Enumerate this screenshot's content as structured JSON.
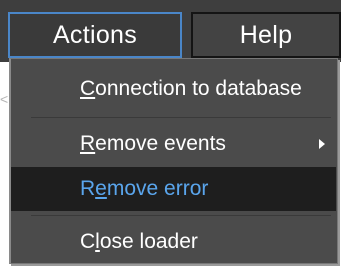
{
  "menubar": {
    "items": [
      {
        "label": "Actions",
        "state": "open"
      },
      {
        "label": "Help"
      }
    ]
  },
  "side_mark": "<",
  "dropdown": {
    "items": [
      {
        "label": "Connection to database",
        "mnemonic": "C",
        "has_submenu": false
      },
      {
        "label": "Remove events",
        "mnemonic": "R",
        "has_submenu": true,
        "submenu_icon": "chevron-right-icon"
      },
      {
        "label": "Remove error",
        "mnemonic": "e",
        "has_submenu": false,
        "selected": true
      },
      {
        "label": "Close loader",
        "mnemonic": "l",
        "has_submenu": false
      }
    ]
  },
  "colors": {
    "menubar_bg": "#3e3e3e",
    "menu_bg": "#4b4b4b",
    "highlight_bg": "#1e1e1e",
    "highlight_text": "#5aa5ec",
    "focus_border": "#4a86c8",
    "text": "#ffffff"
  }
}
